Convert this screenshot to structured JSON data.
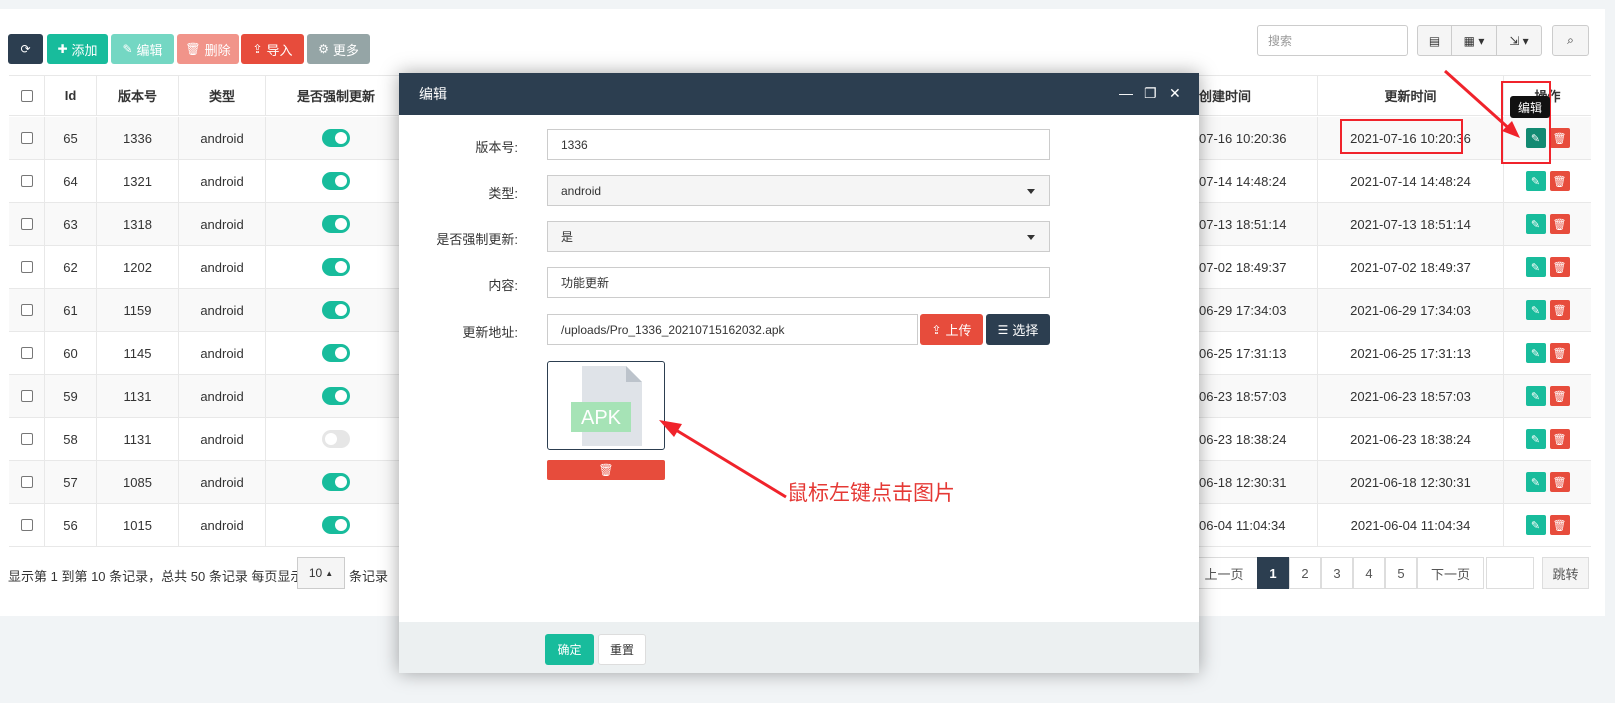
{
  "toolbar": {
    "refresh_icon": "refresh-icon",
    "add_label": "添加",
    "edit_label": "编辑",
    "delete_label": "删除",
    "import_label": "导入",
    "more_label": "更多",
    "search_placeholder": "搜索"
  },
  "table": {
    "headers": [
      "Id",
      "版本号",
      "类型",
      "是否强制更新",
      "创建时间",
      "更新时间",
      "操作"
    ],
    "header_partial_created": "创建时间",
    "header_partial_ops": "操作",
    "rows": [
      {
        "id": "65",
        "version": "1336",
        "type": "android",
        "forced": true,
        "created": "07-16 10:20:36",
        "updated": "2021-07-16 10:20:36"
      },
      {
        "id": "64",
        "version": "1321",
        "type": "android",
        "forced": true,
        "created": "07-14 14:48:24",
        "updated": "2021-07-14 14:48:24"
      },
      {
        "id": "63",
        "version": "1318",
        "type": "android",
        "forced": true,
        "created": "07-13 18:51:14",
        "updated": "2021-07-13 18:51:14"
      },
      {
        "id": "62",
        "version": "1202",
        "type": "android",
        "forced": true,
        "created": "07-02 18:49:37",
        "updated": "2021-07-02 18:49:37"
      },
      {
        "id": "61",
        "version": "1159",
        "type": "android",
        "forced": true,
        "created": "06-29 17:34:03",
        "updated": "2021-06-29 17:34:03"
      },
      {
        "id": "60",
        "version": "1145",
        "type": "android",
        "forced": true,
        "created": "06-25 17:31:13",
        "updated": "2021-06-25 17:31:13"
      },
      {
        "id": "59",
        "version": "1131",
        "type": "android",
        "forced": true,
        "created": "06-23 18:57:03",
        "updated": "2021-06-23 18:57:03"
      },
      {
        "id": "58",
        "version": "1131",
        "type": "android",
        "forced": false,
        "created": "06-23 18:38:24",
        "updated": "2021-06-23 18:38:24"
      },
      {
        "id": "57",
        "version": "1085",
        "type": "android",
        "forced": true,
        "created": "06-18 12:30:31",
        "updated": "2021-06-18 12:30:31"
      },
      {
        "id": "56",
        "version": "1015",
        "type": "android",
        "forced": true,
        "created": "06-04 11:04:34",
        "updated": "2021-06-04 11:04:34"
      }
    ],
    "tooltip": "编辑"
  },
  "footer": {
    "summary": "显示第 1 到第 10 条记录，总共 50 条记录 每页显示",
    "page_size": "10",
    "suffix": "条记录",
    "prev": "上一页",
    "pages": [
      "1",
      "2",
      "3",
      "4",
      "5"
    ],
    "next": "下一页",
    "jump": "跳转"
  },
  "modal": {
    "title": "编辑",
    "fields": {
      "version_label": "版本号:",
      "version_value": "1336",
      "type_label": "类型:",
      "type_value": "android",
      "forced_label": "是否强制更新:",
      "forced_value": "是",
      "content_label": "内容:",
      "content_value": "功能更新",
      "url_label": "更新地址:",
      "url_value": "/uploads/Pro_1336_20210715162032.apk",
      "upload_label": "上传",
      "choose_label": "选择"
    },
    "thumb_text": "APK",
    "ok_label": "确定",
    "reset_label": "重置"
  },
  "annotation": {
    "text": "鼠标左键点击图片"
  },
  "colors": {
    "primary": "#18bc9c",
    "danger": "#e74c3c",
    "dark": "#2c3e50",
    "annotation": "#e53935"
  }
}
